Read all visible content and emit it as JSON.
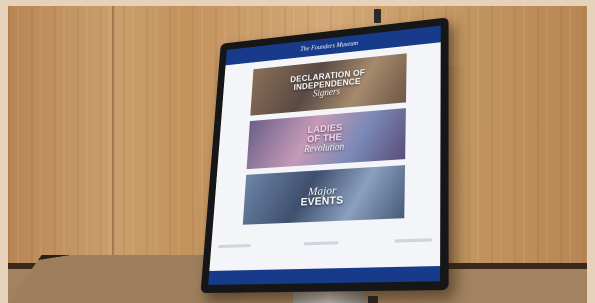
{
  "kiosk": {
    "museum_name": "The Founders Museum",
    "tiles": [
      {
        "lines": [
          "Declaration of",
          "Independence"
        ],
        "script": "Signers"
      },
      {
        "lines": [
          "Ladies",
          "of the"
        ],
        "script": "Revolution"
      },
      {
        "script": "Major",
        "lines": [
          "Events"
        ]
      }
    ]
  },
  "colors": {
    "header_blue": "#173a8a",
    "wood": "#c79a66",
    "frame": "#e6d2bb"
  }
}
